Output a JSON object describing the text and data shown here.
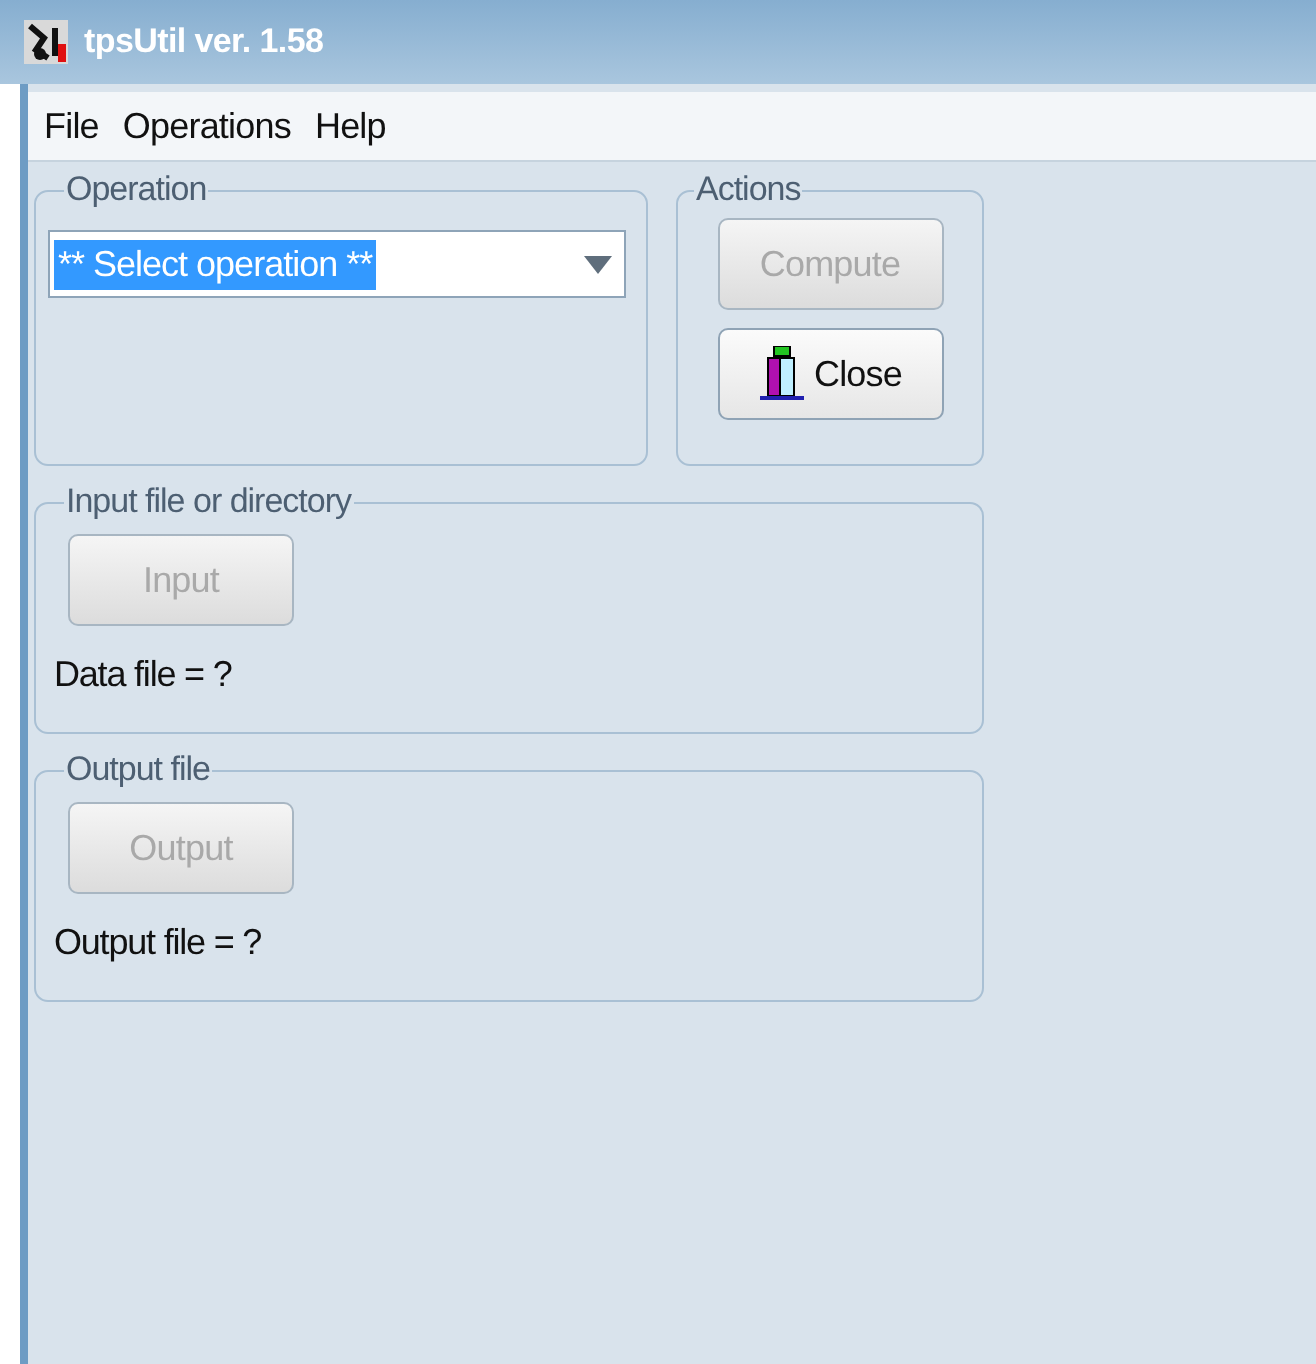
{
  "window": {
    "title": "tpsUtil ver. 1.58"
  },
  "menu": [
    "File",
    "Operations",
    "Help"
  ],
  "operation": {
    "legend": "Operation",
    "dropdown": {
      "value": "** Select operation **",
      "selected": true
    }
  },
  "actions": {
    "legend": "Actions",
    "buttons": [
      {
        "label": "Compute",
        "disabled": true,
        "kind": "plain"
      },
      {
        "label": "Close",
        "disabled": false,
        "kind": "exit"
      }
    ]
  },
  "input": {
    "legend": "Input file or directory",
    "button": {
      "label": "Input",
      "disabled": true
    },
    "status": "Data file = ?"
  },
  "output": {
    "legend": "Output file",
    "button": {
      "label": "Output",
      "disabled": true
    },
    "status": "Output file = ?"
  }
}
